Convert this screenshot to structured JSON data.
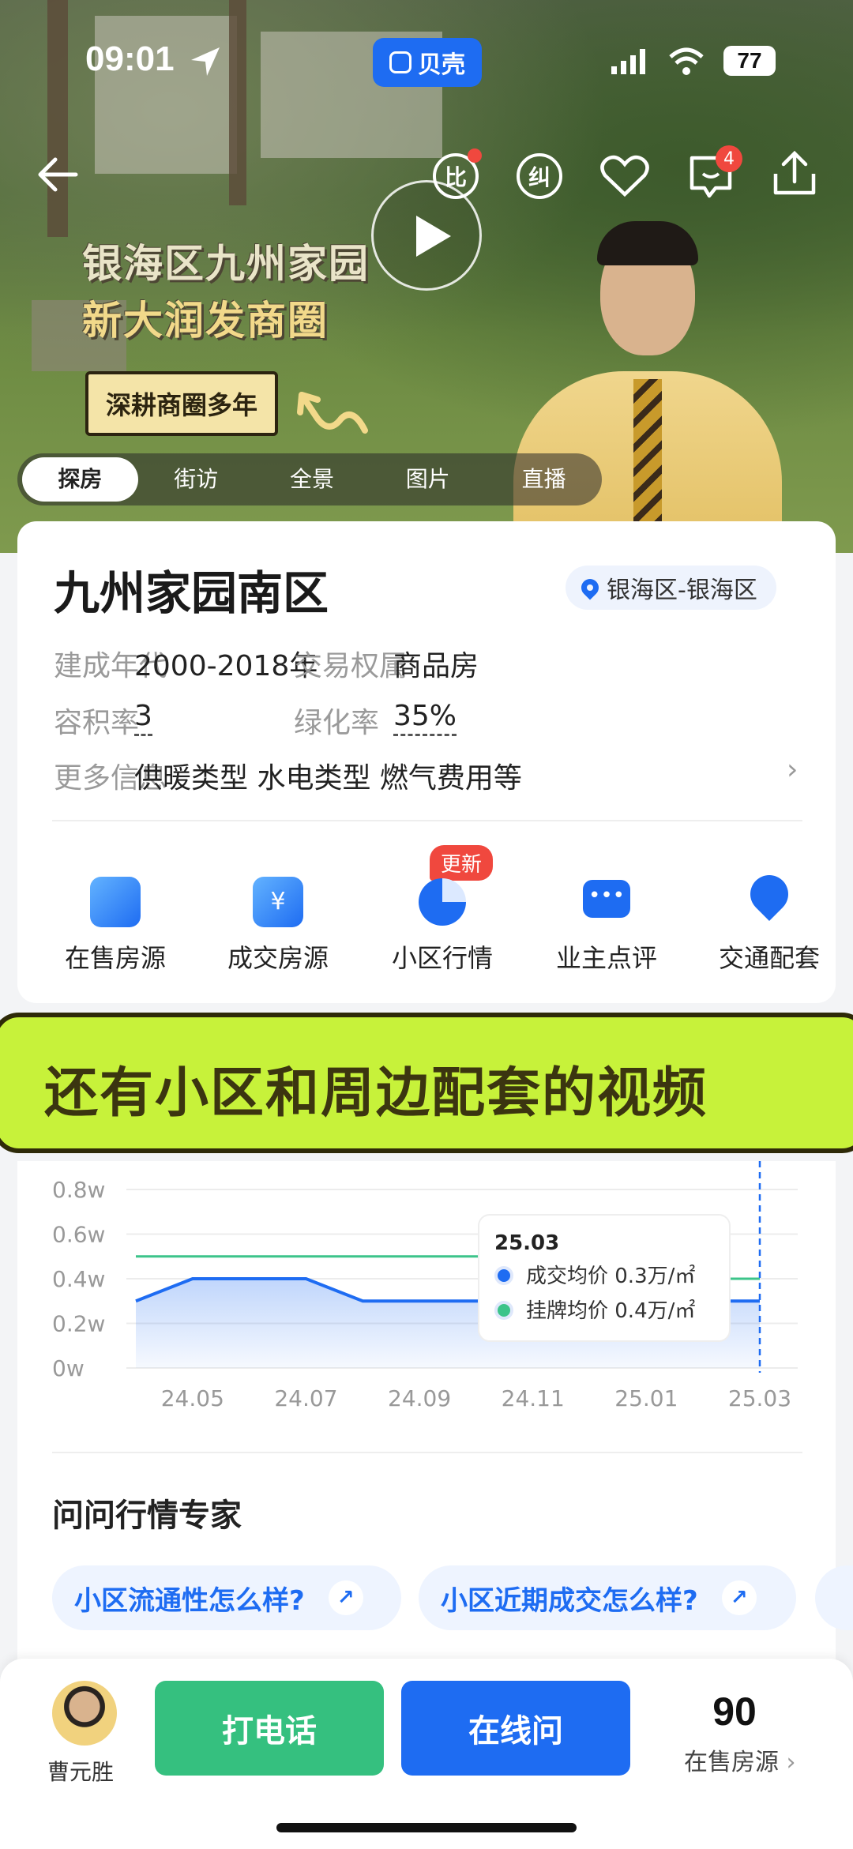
{
  "status_bar": {
    "time": "09:01",
    "battery": "77"
  },
  "app_badge": "贝壳",
  "header": {
    "compare_label": "比",
    "correct_label": "纠",
    "message_count": "4"
  },
  "video": {
    "title_line1": "银海区九州家园",
    "title_line2": "新大润发商圈",
    "tag": "深耕商圈多年"
  },
  "media_tabs": [
    {
      "label": "探房",
      "active": true
    },
    {
      "label": "街访",
      "active": false
    },
    {
      "label": "全景",
      "active": false
    },
    {
      "label": "图片",
      "active": false
    },
    {
      "label": "直播",
      "active": false
    }
  ],
  "community": {
    "name": "九州家园南区",
    "location": "银海区-银海区",
    "rows": [
      {
        "label1": "建成年代",
        "value1": "2000-2018年",
        "label2": "交易权属",
        "value2": "商品房"
      },
      {
        "label1": "容积率",
        "value1": "3",
        "label2": "绿化率",
        "value2": "35%"
      }
    ],
    "more_label": "更多信息",
    "more_value": "供暖类型 水电类型 燃气费用等"
  },
  "quick_links": [
    {
      "label": "在售房源",
      "icon": "listing-icon"
    },
    {
      "label": "成交房源",
      "icon": "yuan-icon"
    },
    {
      "label": "小区行情",
      "icon": "pie-chart-icon"
    },
    {
      "label": "业主点评",
      "icon": "chat-icon"
    },
    {
      "label": "交通配套",
      "icon": "map-pin-icon"
    }
  ],
  "update_badge": "更新",
  "banner_text": "还有小区和周边配套的视频",
  "chart_data": {
    "type": "line",
    "x": [
      "24.04",
      "24.05",
      "24.06",
      "24.07",
      "24.08",
      "24.09",
      "24.10",
      "24.11",
      "24.12",
      "25.01",
      "25.02",
      "25.03"
    ],
    "x_tick_labels": [
      "24.05",
      "24.07",
      "24.09",
      "24.11",
      "25.01",
      "25.03"
    ],
    "y_tick_labels": [
      "0.8w",
      "0.6w",
      "0.4w",
      "0.2w",
      "0w"
    ],
    "ylim": [
      0,
      0.8
    ],
    "series": [
      {
        "name": "成交均价",
        "color": "#1e6cf2",
        "values": [
          0.3,
          0.4,
          0.4,
          0.4,
          0.3,
          0.3,
          0.3,
          0.3,
          0.3,
          0.3,
          0.3,
          0.3
        ]
      },
      {
        "name": "挂牌均价",
        "color": "#3cc48a",
        "values": [
          0.5,
          0.5,
          0.5,
          0.5,
          0.5,
          0.5,
          0.5,
          0.5,
          0.5,
          0.4,
          0.4,
          0.4
        ]
      }
    ],
    "tooltip": {
      "date": "25.03",
      "items": [
        {
          "label": "成交均价 0.3万/㎡",
          "color": "#1e6cf2"
        },
        {
          "label": "挂牌均价 0.4万/㎡",
          "color": "#3cc48a"
        }
      ]
    }
  },
  "ask_title": "问问行情专家",
  "questions": [
    "小区流通性怎么样?",
    "小区近期成交怎么样?"
  ],
  "bottom_bar": {
    "agent_name": "曹元胜",
    "call_label": "打电话",
    "chat_label": "在线问",
    "listing_count": "90",
    "listing_label": "在售房源"
  },
  "colors": {
    "accent": "#1e6cf2",
    "call": "#35c07f",
    "banner": "#c7f23a",
    "alert": "#f0483e"
  }
}
